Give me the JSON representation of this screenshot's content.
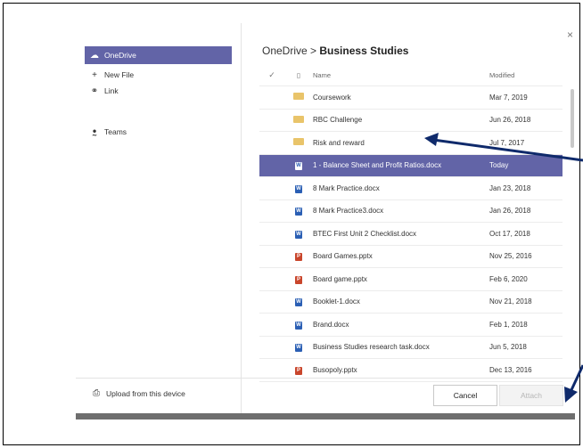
{
  "sidebar": {
    "items": [
      {
        "label": "OneDrive",
        "icon": "cloud-icon",
        "active": true
      },
      {
        "label": "New File",
        "icon": "plus-icon",
        "active": false
      },
      {
        "label": "Link",
        "icon": "link-icon",
        "active": false
      },
      {
        "label": "Teams",
        "icon": "teams-icon",
        "active": false
      }
    ],
    "upload_label": "Upload from this device"
  },
  "breadcrumb": {
    "root": "OneDrive",
    "separator": ">",
    "current": "Business Studies"
  },
  "table": {
    "columns": {
      "name": "Name",
      "modified": "Modified"
    },
    "rows": [
      {
        "type": "folder",
        "name": "Coursework",
        "modified": "Mar 7, 2019"
      },
      {
        "type": "folder",
        "name": "RBC Challenge",
        "modified": "Jun 26, 2018"
      },
      {
        "type": "folder",
        "name": "Risk and reward",
        "modified": "Jul 7, 2017"
      },
      {
        "type": "docx",
        "name": "1 - Balance Sheet and Profit Ratios.docx",
        "modified": "Today",
        "selected": true
      },
      {
        "type": "docx",
        "name": "8 Mark Practice.docx",
        "modified": "Jan 23, 2018"
      },
      {
        "type": "docx",
        "name": "8 Mark Practice3.docx",
        "modified": "Jan 26, 2018"
      },
      {
        "type": "docx",
        "name": "BTEC First Unit 2 Checklist.docx",
        "modified": "Oct 17, 2018"
      },
      {
        "type": "pptx",
        "name": "Board Games.pptx",
        "modified": "Nov 25, 2016"
      },
      {
        "type": "pptx",
        "name": "Board game.pptx",
        "modified": "Feb 6, 2020"
      },
      {
        "type": "docx",
        "name": "Booklet-1.docx",
        "modified": "Nov 21, 2018"
      },
      {
        "type": "docx",
        "name": "Brand.docx",
        "modified": "Feb 1, 2018"
      },
      {
        "type": "docx",
        "name": "Business Studies research task.docx",
        "modified": "Jun 5, 2018"
      },
      {
        "type": "pptx",
        "name": "Busopoly.pptx",
        "modified": "Dec 13, 2016"
      }
    ]
  },
  "buttons": {
    "cancel": "Cancel",
    "attach": "Attach"
  },
  "close_glyph": "×",
  "colors": {
    "accent": "#6264a7",
    "arrow": "#0f2a6b"
  }
}
